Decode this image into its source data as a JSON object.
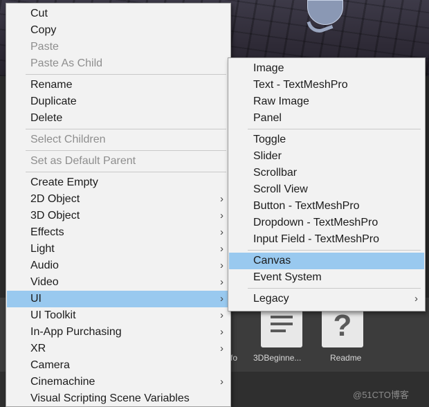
{
  "context_menu": {
    "groups": [
      [
        {
          "label": "Cut",
          "enabled": true
        },
        {
          "label": "Copy",
          "enabled": true
        },
        {
          "label": "Paste",
          "enabled": false
        },
        {
          "label": "Paste As Child",
          "enabled": false
        }
      ],
      [
        {
          "label": "Rename",
          "enabled": true
        },
        {
          "label": "Duplicate",
          "enabled": true
        },
        {
          "label": "Delete",
          "enabled": true
        }
      ],
      [
        {
          "label": "Select Children",
          "enabled": false
        }
      ],
      [
        {
          "label": "Set as Default Parent",
          "enabled": false
        }
      ],
      [
        {
          "label": "Create Empty",
          "enabled": true
        },
        {
          "label": "2D Object",
          "enabled": true,
          "submenu": true
        },
        {
          "label": "3D Object",
          "enabled": true,
          "submenu": true
        },
        {
          "label": "Effects",
          "enabled": true,
          "submenu": true
        },
        {
          "label": "Light",
          "enabled": true,
          "submenu": true
        },
        {
          "label": "Audio",
          "enabled": true,
          "submenu": true
        },
        {
          "label": "Video",
          "enabled": true,
          "submenu": true
        },
        {
          "label": "UI",
          "enabled": true,
          "submenu": true,
          "selected": true
        },
        {
          "label": "UI Toolkit",
          "enabled": true,
          "submenu": true
        },
        {
          "label": "In-App Purchasing",
          "enabled": true,
          "submenu": true
        },
        {
          "label": "XR",
          "enabled": true,
          "submenu": true
        },
        {
          "label": "Camera",
          "enabled": true
        },
        {
          "label": "Cinemachine",
          "enabled": true,
          "submenu": true
        },
        {
          "label": "Visual Scripting Scene Variables",
          "enabled": true
        }
      ]
    ]
  },
  "ui_submenu": {
    "groups": [
      [
        {
          "label": "Image"
        },
        {
          "label": "Text - TextMeshPro"
        },
        {
          "label": "Raw Image"
        },
        {
          "label": "Panel"
        }
      ],
      [
        {
          "label": "Toggle"
        },
        {
          "label": "Slider"
        },
        {
          "label": "Scrollbar"
        },
        {
          "label": "Scroll View"
        },
        {
          "label": "Button - TextMeshPro"
        },
        {
          "label": "Dropdown - TextMeshPro"
        },
        {
          "label": "Input Field - TextMeshPro"
        }
      ],
      [
        {
          "label": "Canvas",
          "selected": true
        },
        {
          "label": "Event System"
        }
      ],
      [
        {
          "label": "Legacy",
          "submenu": true
        }
      ]
    ]
  },
  "submenu_arrow": "›",
  "project_assets": [
    {
      "label": "3DBeginne...",
      "icon": "document-icon"
    },
    {
      "label": "Readme",
      "icon": "question-icon"
    }
  ],
  "asset_fragment": "fo",
  "watermark": "@51CTO博客",
  "colors": {
    "menu_bg": "#f2f2f2",
    "highlight": "#99c9ef",
    "disabled_text": "#8e8e8e"
  }
}
